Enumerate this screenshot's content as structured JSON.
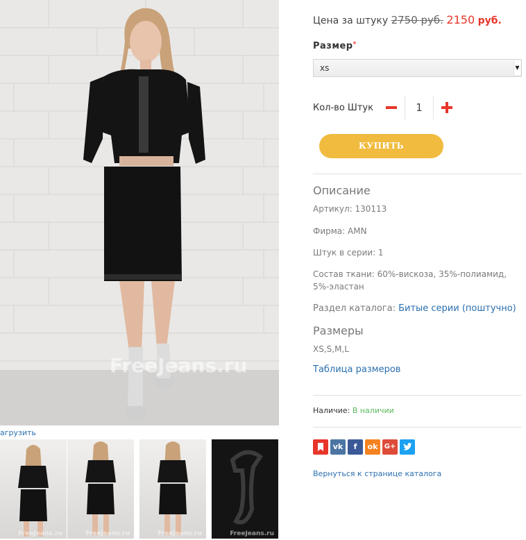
{
  "gallery": {
    "watermark": "FreeJeans.ru",
    "thumb_watermark": "FreeJeans.ru",
    "zoom_link": "агрузить"
  },
  "product": {
    "price_label": "Цена за штуку",
    "old_price": "2750 руб.",
    "new_price": "2150",
    "currency": "руб.",
    "size_label": "Размер",
    "required_mark": "*",
    "size_selected": "xs",
    "qty_label": "Кол-во Штук",
    "qty_value": "1",
    "buy_label": "КУПИТЬ"
  },
  "description": {
    "title": "Описание",
    "article": "Артикул: 130113",
    "firm": "Фирма: AMN",
    "pieces": "Штук в серии: 1",
    "fabric": "Состав ткани: 60%-вискоза, 35%-полиамид, 5%-эластан",
    "catalog_prefix": "Раздел каталога: ",
    "catalog_link": "Битые серии (поштучно)"
  },
  "sizes": {
    "title": "Размеры",
    "values": "XS,S,M,L",
    "table_link": "Таблица размеров"
  },
  "availability": {
    "label": "Наличие: ",
    "status": "В наличии"
  },
  "social": [
    {
      "name": "bookmark-icon",
      "glyph": "",
      "color": "#e8352a"
    },
    {
      "name": "vk-icon",
      "glyph": "vk",
      "color": "#4c75a3"
    },
    {
      "name": "facebook-icon",
      "glyph": "f",
      "color": "#3b5998"
    },
    {
      "name": "odnoklassniki-icon",
      "glyph": "ok",
      "color": "#f58220"
    },
    {
      "name": "google-plus-icon",
      "glyph": "G+",
      "color": "#dd4b39"
    },
    {
      "name": "twitter-icon",
      "glyph": "t",
      "color": "#1da1f2"
    }
  ],
  "back_link": "Вернуться к странице каталога",
  "colors": {
    "accent_red": "#e8352a",
    "buy_button": "#f0bb3f",
    "link_blue": "#2a6fb0",
    "in_stock_green": "#5cb85c"
  }
}
